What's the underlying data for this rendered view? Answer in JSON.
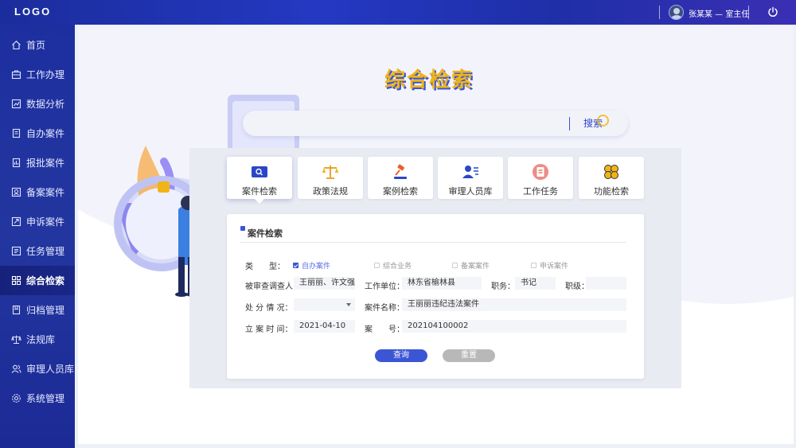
{
  "app": {
    "logo": "LOGO"
  },
  "header": {
    "user": "张某某 — 室主任"
  },
  "sidebar": {
    "items": [
      {
        "label": "首页",
        "icon": "home-icon"
      },
      {
        "label": "工作办理",
        "icon": "briefcase-icon"
      },
      {
        "label": "数据分析",
        "icon": "chart-icon"
      },
      {
        "label": "自办案件",
        "icon": "document-icon"
      },
      {
        "label": "报批案件",
        "icon": "report-icon"
      },
      {
        "label": "备案案件",
        "icon": "record-icon"
      },
      {
        "label": "申诉案件",
        "icon": "appeal-icon"
      },
      {
        "label": "任务管理",
        "icon": "task-icon"
      },
      {
        "label": "综合检索",
        "icon": "grid-icon",
        "active": true
      },
      {
        "label": "归档管理",
        "icon": "archive-icon"
      },
      {
        "label": "法规库",
        "icon": "scales-icon"
      },
      {
        "label": "审理人员库",
        "icon": "people-icon"
      },
      {
        "label": "系统管理",
        "icon": "settings-icon"
      }
    ]
  },
  "main": {
    "title": "综合检索",
    "search": {
      "placeholder": "",
      "button": "搜索"
    },
    "tabs": [
      {
        "label": "案件检索",
        "icon": "case-search-icon",
        "active": true
      },
      {
        "label": "政策法规",
        "icon": "scales-icon"
      },
      {
        "label": "案例检索",
        "icon": "gavel-icon"
      },
      {
        "label": "审理人员库",
        "icon": "person-card-icon"
      },
      {
        "label": "工作任务",
        "icon": "clipboard-icon"
      },
      {
        "label": "功能检索",
        "icon": "clover-icon"
      }
    ],
    "form": {
      "title": "案件检索",
      "type_label": "类　　型：",
      "types": [
        {
          "label": "自办案件",
          "checked": true
        },
        {
          "label": "综合业务",
          "checked": false
        },
        {
          "label": "备案案件",
          "checked": false
        },
        {
          "label": "申诉案件",
          "checked": false
        }
      ],
      "subject_label": "被审查调查人：",
      "subject_value": "王丽丽、许文强",
      "unit_label": "工作单位：",
      "unit_value": "林东省榆林县",
      "duty_label": "职务：",
      "duty_value": "书记",
      "rank_label": "职级：",
      "rank_value": "",
      "disposal_label": "处 分 情 况：",
      "disposal_value": "",
      "case_name_label": "案件名称：",
      "case_name_value": "王丽丽违纪违法案件",
      "date_label": "立 案 时 间：",
      "date_value": "2021-04-10",
      "case_no_label": "案　　号：",
      "case_no_value": "202104100002",
      "query_button": "查询",
      "reset_button": "重置"
    }
  },
  "colors": {
    "primary": "#3b56d4",
    "accent": "#f0b418",
    "sidebar": "#1d2f9f"
  }
}
